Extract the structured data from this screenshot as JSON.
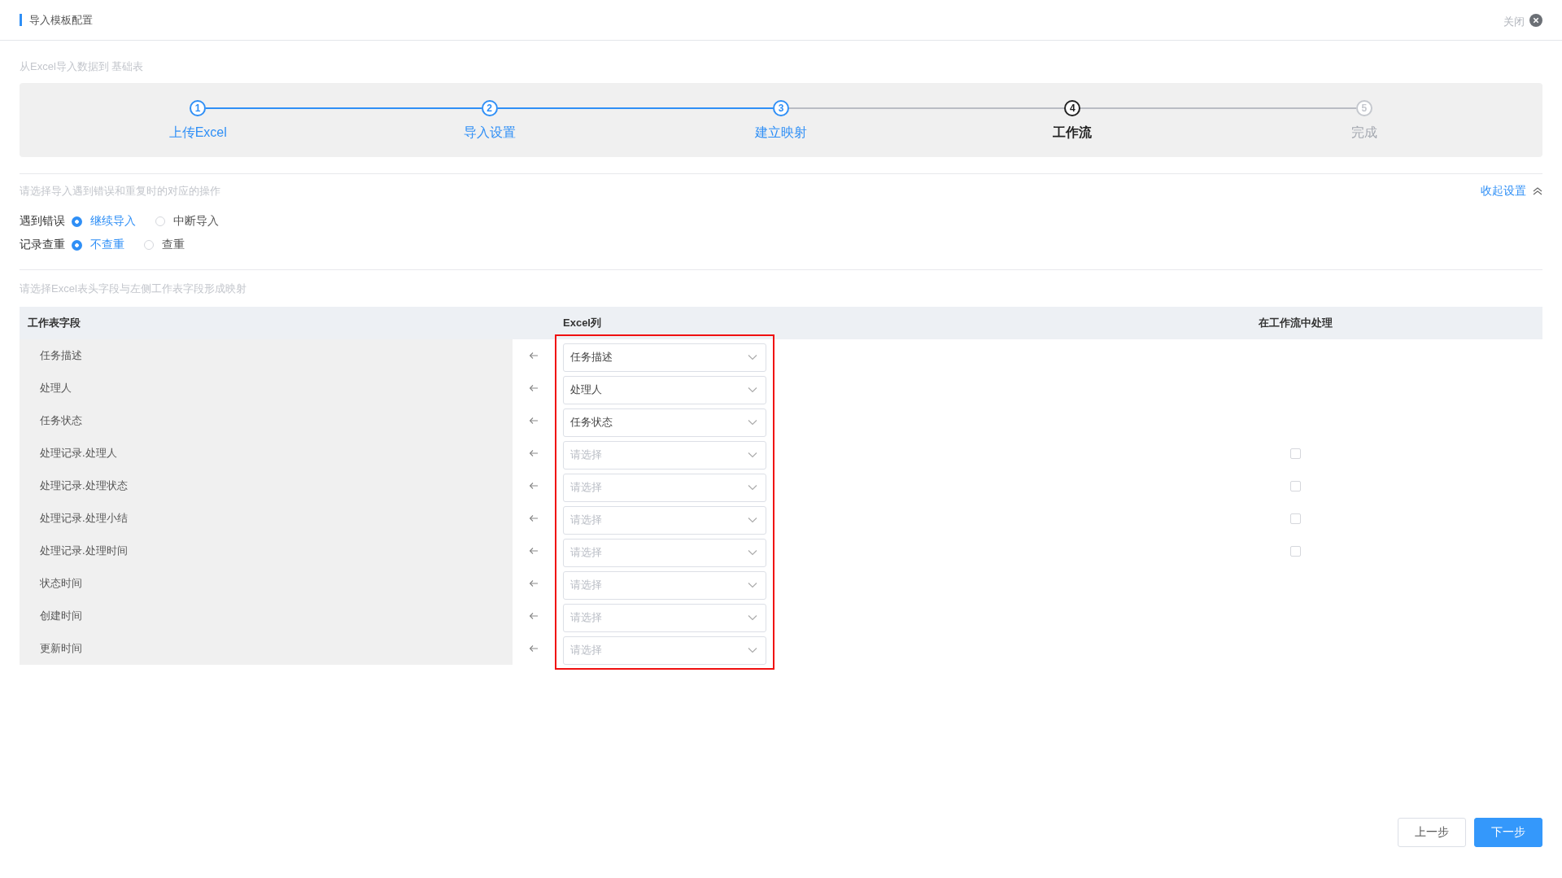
{
  "window": {
    "title": "导入模板配置",
    "close_label": "关闭"
  },
  "subtitle": "从Excel导入数据到 基础表",
  "steps": [
    {
      "number": "1",
      "label": "上传Excel",
      "completed": true,
      "current": false
    },
    {
      "number": "2",
      "label": "导入设置",
      "completed": true,
      "current": false
    },
    {
      "number": "3",
      "label": "建立映射",
      "completed": true,
      "current": false
    },
    {
      "number": "4",
      "label": "工作流",
      "completed": false,
      "current": true
    },
    {
      "number": "5",
      "label": "完成",
      "completed": false,
      "current": false
    }
  ],
  "settings": {
    "hint": "请选择导入遇到错误和重复时的对应的操作",
    "collapse_label": "收起设置",
    "groups": [
      {
        "label": "遇到错误",
        "options": [
          {
            "label": "继续导入",
            "selected": true
          },
          {
            "label": "中断导入",
            "selected": false
          }
        ]
      },
      {
        "label": "记录查重",
        "options": [
          {
            "label": "不查重",
            "selected": true
          },
          {
            "label": "查重",
            "selected": false
          }
        ]
      }
    ]
  },
  "mapping": {
    "hint": "请选择Excel表头字段与左侧工作表字段形成映射",
    "columns": [
      "工作表字段",
      "Excel列",
      "在工作流中处理"
    ],
    "highlight_excel_column": true,
    "rows": [
      {
        "field": "任务描述",
        "value": "任务描述"
      },
      {
        "field": "处理人",
        "value": "处理人"
      },
      {
        "field": "任务状态",
        "value": "任务状态"
      },
      {
        "field": "处理记录.处理人",
        "placeholder": "请选择",
        "in_workflow": false
      },
      {
        "field": "处理记录.处理状态",
        "placeholder": "请选择",
        "in_workflow": false
      },
      {
        "field": "处理记录.处理小结",
        "placeholder": "请选择",
        "in_workflow": false
      },
      {
        "field": "处理记录.处理时间",
        "placeholder": "请选择",
        "in_workflow": false
      },
      {
        "field": "状态时间",
        "placeholder": "请选择"
      },
      {
        "field": "创建时间",
        "placeholder": "请选择"
      },
      {
        "field": "更新时间",
        "placeholder": "请选择"
      }
    ]
  },
  "buttons": [
    {
      "label": "上一步",
      "kind": "secondary"
    },
    {
      "label": "下一步",
      "kind": "primary"
    }
  ]
}
